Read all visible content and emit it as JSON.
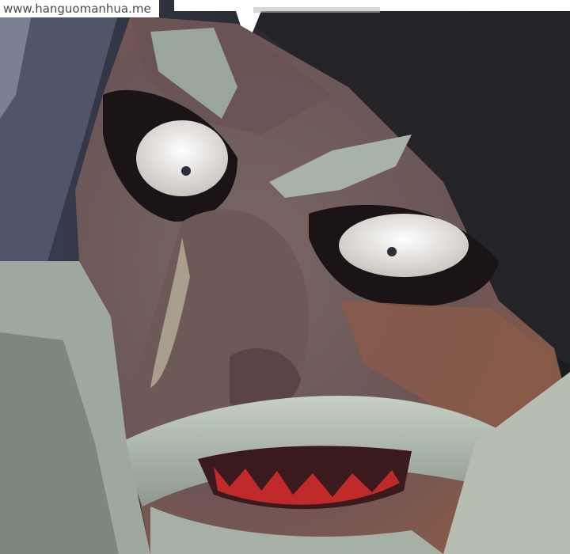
{
  "watermark": {
    "text": "www.hanguomanhua.me"
  },
  "colors": {
    "background_dark": "#1e1d20",
    "hood_light": "#6b6e82",
    "skin_mid": "#74605e",
    "skin_shadow": "#5a4648",
    "skin_warm": "#8a5c4c",
    "beard": "#b8c0b4",
    "beard_shadow": "#6f7a72",
    "mouth_red": "#c02a2a",
    "eye_white": "#e9e6e2",
    "speech_bubble": "#ffffff"
  }
}
